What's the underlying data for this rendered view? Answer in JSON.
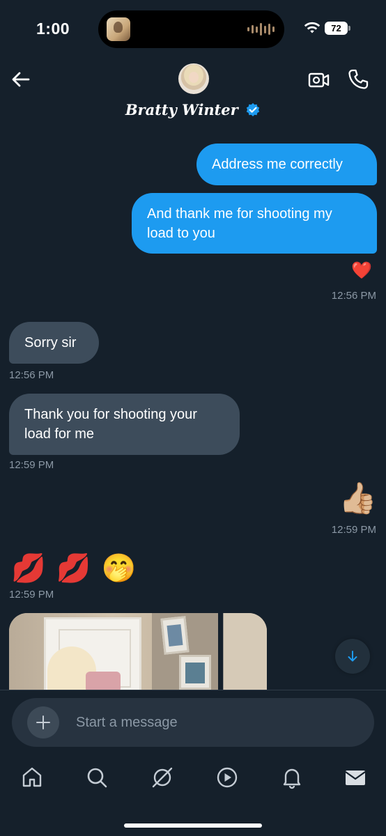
{
  "status_bar": {
    "time": "1:00",
    "battery_level": "72"
  },
  "header": {
    "contact_name": "Bratty Winter",
    "verified": true,
    "accent_color": "#1d9bf0"
  },
  "messages": [
    {
      "direction": "sent",
      "text": "Address me correctly"
    },
    {
      "direction": "sent",
      "text": "And thank me for shooting my load to you"
    },
    {
      "direction": "sent",
      "reaction": "❤️",
      "timestamp": "12:56 PM"
    },
    {
      "direction": "received",
      "text": "Sorry sir",
      "timestamp": "12:56 PM"
    },
    {
      "direction": "received",
      "text": "Thank you for shooting your load for me",
      "timestamp": "12:59 PM"
    },
    {
      "direction": "sent",
      "emoji": "👍🏼",
      "timestamp": "12:59 PM"
    },
    {
      "direction": "received",
      "emoji": "💋 💋 🤭",
      "timestamp": "12:59 PM"
    },
    {
      "direction": "received",
      "type": "image"
    }
  ],
  "composer": {
    "placeholder": "Start a message"
  },
  "icons": {
    "back": "arrow-left-icon",
    "video": "video-call-icon",
    "phone": "phone-icon",
    "scroll_down": "arrow-down-icon",
    "add": "plus-icon",
    "voice": "voice-waveform-icon"
  },
  "bottom_nav": [
    "home-icon",
    "search-icon",
    "grok-icon",
    "play-icon",
    "bell-icon",
    "mail-icon"
  ]
}
